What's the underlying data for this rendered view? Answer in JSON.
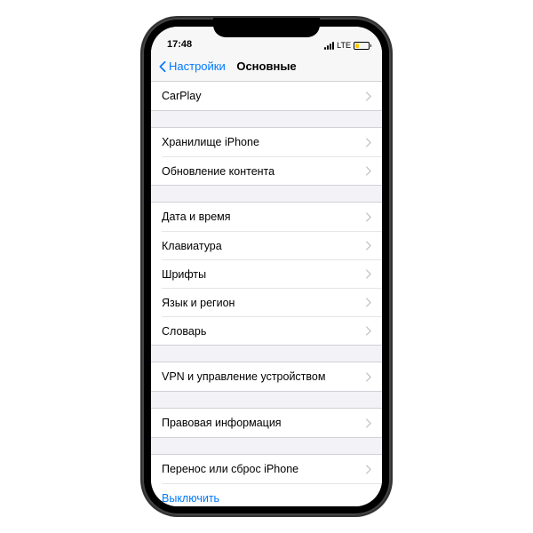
{
  "status": {
    "time": "17:48",
    "network": "LTE"
  },
  "nav": {
    "back": "Настройки",
    "title": "Основные"
  },
  "groups": [
    {
      "rows": [
        {
          "label": "CarPlay",
          "chevron": true
        }
      ]
    },
    {
      "rows": [
        {
          "label": "Хранилище iPhone",
          "chevron": true
        },
        {
          "label": "Обновление контента",
          "chevron": true
        }
      ]
    },
    {
      "rows": [
        {
          "label": "Дата и время",
          "chevron": true
        },
        {
          "label": "Клавиатура",
          "chevron": true
        },
        {
          "label": "Шрифты",
          "chevron": true
        },
        {
          "label": "Язык и регион",
          "chevron": true
        },
        {
          "label": "Словарь",
          "chevron": true
        }
      ]
    },
    {
      "rows": [
        {
          "label": "VPN и управление устройством",
          "chevron": true
        }
      ]
    },
    {
      "rows": [
        {
          "label": "Правовая информация",
          "chevron": true
        }
      ]
    },
    {
      "rows": [
        {
          "label": "Перенос или сброс iPhone",
          "chevron": true
        },
        {
          "label": "Выключить",
          "chevron": false,
          "link": true
        }
      ]
    }
  ]
}
